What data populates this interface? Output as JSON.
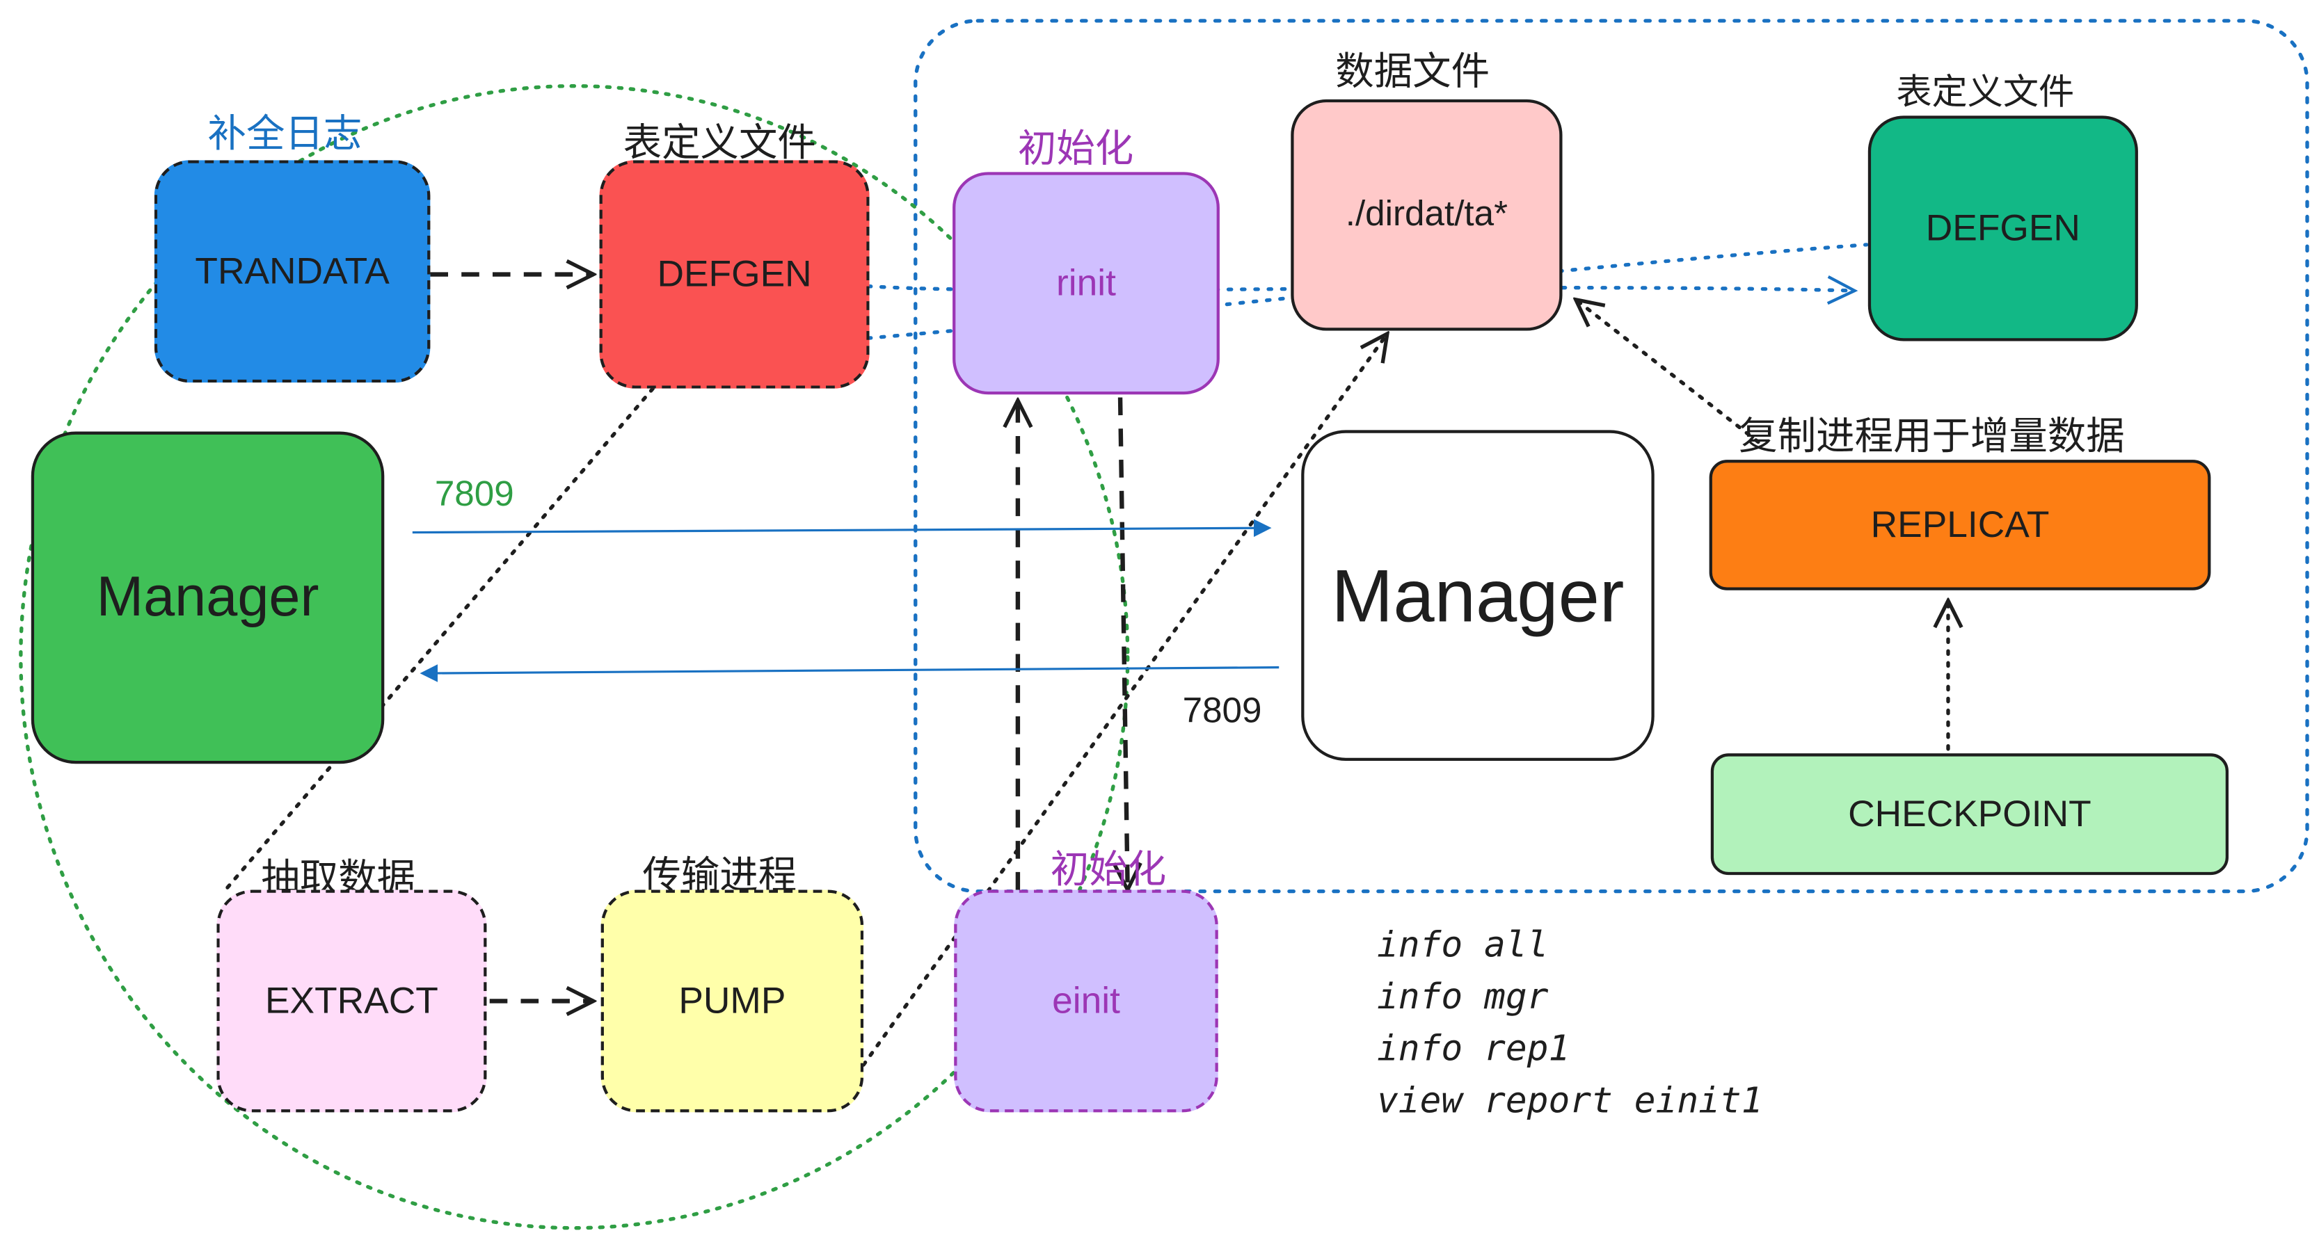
{
  "colors": {
    "trandata": "#228be6",
    "defgen_src": "#fa5252",
    "manager_src": "#40c057",
    "extract": "#ffdcf9",
    "pump": "#ffffaa",
    "init": "#d0bfff",
    "datafile": "#ffc9c9",
    "defgen_tgt": "#12b886",
    "replicat": "#fd7e14",
    "checkpoint": "#b2f2bb",
    "blue_label": "#1971c2",
    "green_label": "#2f9e44",
    "purple_label": "#9c36b5"
  },
  "source": {
    "trandata": {
      "label": "TRANDATA",
      "caption": "补全日志"
    },
    "defgen": {
      "label": "DEFGEN",
      "caption": "表定义文件"
    },
    "manager": {
      "label": "Manager"
    },
    "extract": {
      "label": "EXTRACT",
      "caption": "抽取数据"
    },
    "pump": {
      "label": "PUMP",
      "caption": "传输进程"
    },
    "einit": {
      "label": "einit",
      "caption": "初始化"
    }
  },
  "target": {
    "rinit": {
      "label": "rinit",
      "caption": "初始化"
    },
    "datafile": {
      "label": "./dirdat/ta*",
      "caption": "数据文件"
    },
    "defgen": {
      "label": "DEFGEN",
      "caption": "表定义文件"
    },
    "manager": {
      "label": "Manager"
    },
    "replicat": {
      "label": "REPLICAT",
      "caption": "复制进程用于增量数据"
    },
    "checkpoint": {
      "label": "CHECKPOINT"
    }
  },
  "ports": {
    "to_target": "7809",
    "to_source": "7809"
  },
  "commands": [
    "info all",
    "info mgr",
    "info rep1",
    "view report einit1"
  ]
}
